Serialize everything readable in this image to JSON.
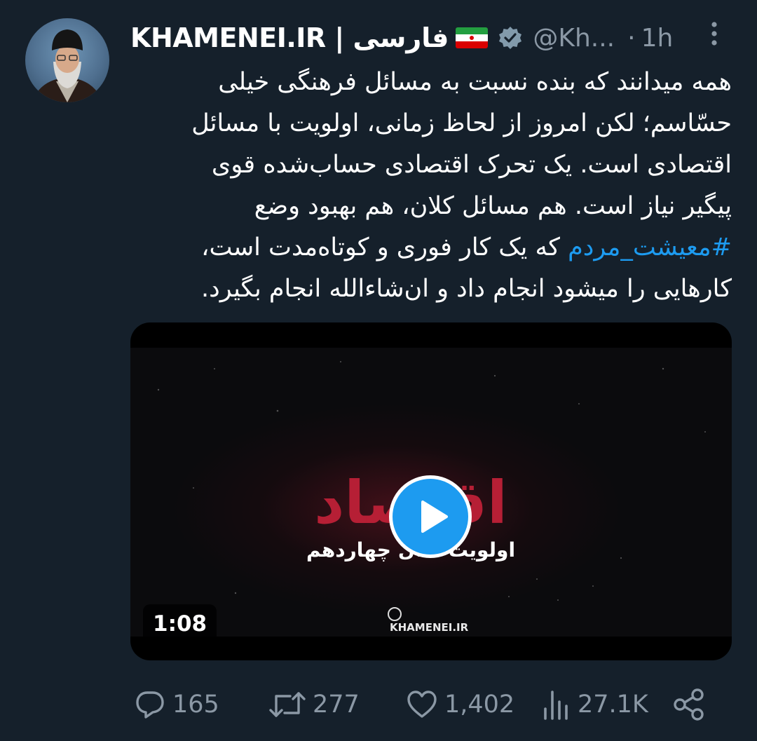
{
  "tweet": {
    "display_name": "KHAMENEI.IR | فارسی",
    "handle": "@Kh...",
    "separator": "·",
    "time": "1h",
    "text_lines": [
      "همه میدانند که بنده نسبت به مسائل فرهنگی خیلی",
      "حسّاسم؛ لکن امروز از لحاظ زمانی، اولویت با مسائل",
      "اقتصادی است. یک تحرک اقتصادی حساب‌شده قوی",
      "پیگیر نیاز است. هم مسائل کلان، هم بهبود وضع"
    ],
    "hashtag": "#معیشت_مردم",
    "line5_rest": " که یک کار فوری و کوتاه‌مدت است،",
    "line6": "کارهایی را میشود انجام داد و ان‌شاءالله انجام بگیرد."
  },
  "media": {
    "duration": "1:08",
    "title_art": "اقتصاد",
    "subtitle_art": "اولویت سال چهاردهم",
    "watermark": "KHAMENEI.IR"
  },
  "actions": {
    "replies": "165",
    "retweets": "277",
    "likes": "1,402",
    "views": "27.1K"
  },
  "icons": {
    "more": "more-vertical-icon",
    "verified": "verified-badge-icon",
    "flag": "iran-flag-icon",
    "reply": "reply-icon",
    "retweet": "retweet-icon",
    "like": "like-icon",
    "views": "views-icon",
    "share": "share-icon",
    "play": "play-icon"
  },
  "colors": {
    "background": "#15202b",
    "secondary_text": "#8b98a5",
    "accent": "#1d9bf0"
  }
}
